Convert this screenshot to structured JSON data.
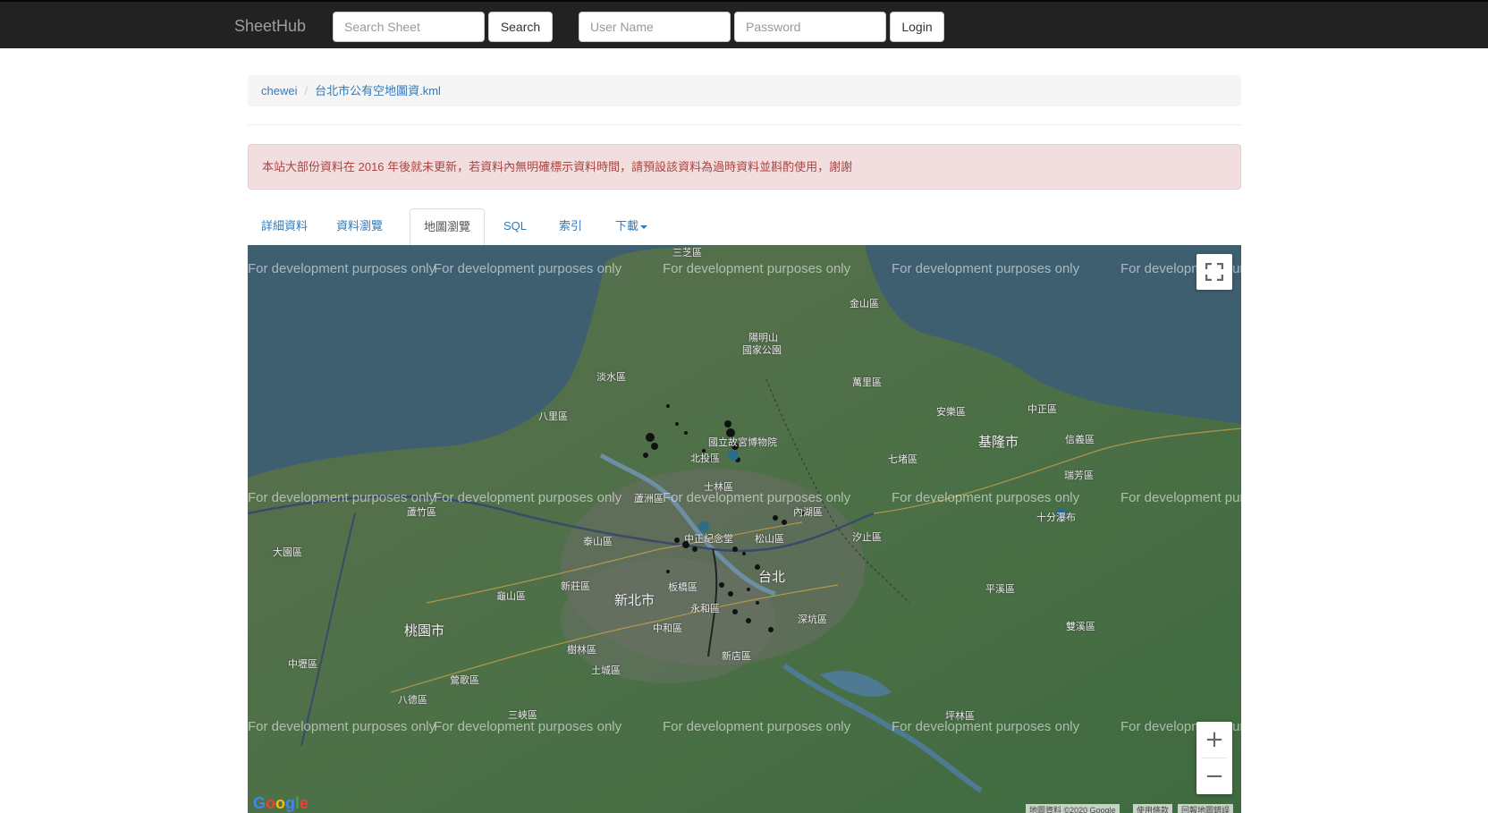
{
  "navbar": {
    "brand": "SheetHub",
    "search_placeholder": "Search Sheet",
    "search_button": "Search",
    "username_placeholder": "User Name",
    "password_placeholder": "Password",
    "login_button": "Login"
  },
  "breadcrumb": {
    "user": "chewei",
    "separator": "/",
    "file": "台北市公有空地圖資.kml"
  },
  "alert": {
    "text": "本站大部份資料在 2016 年後就未更新，若資料內無明確標示資料時間，請預設該資料為過時資料並斟酌使用，謝謝"
  },
  "tabs": [
    {
      "label": "詳細資料",
      "active": false
    },
    {
      "label": "資料瀏覽",
      "active": false
    },
    {
      "label": "地圖瀏覽",
      "active": true
    },
    {
      "label": "SQL",
      "active": false
    },
    {
      "label": "索引",
      "active": false
    },
    {
      "label": "下載",
      "active": false,
      "dropdown": true
    }
  ],
  "map": {
    "watermark": "For development purposes only",
    "place_labels": {
      "sanzhi": "三芝區",
      "jinshan": "金山區",
      "yangmingshan": "陽明山",
      "national_park": "國家公園",
      "danshui": "淡水區",
      "wanli": "萬里區",
      "bali": "八里區",
      "anle": "安樂區",
      "zhongzheng_kl": "中正區",
      "keelung": "基隆市",
      "xinyi_kl": "信義區",
      "palace_museum": "國立故宮博物院",
      "beitou": "北投區",
      "qidu": "七堵區",
      "ruifang": "瑞芳區",
      "shilin": "士林區",
      "luzhou": "蘆洲區",
      "luzhu": "蘆竹區",
      "neihu": "內湖區",
      "shifen": "十分瀑布",
      "dayuan": "大園區",
      "taishan": "泰山區",
      "cks_memorial": "中正紀念堂",
      "songshan": "松山區",
      "xizhi": "汐止區",
      "xinzhuang": "新莊區",
      "taipei": "台北",
      "guishan": "龜山區",
      "newtaipei": "新北市",
      "banqiao": "板橋區",
      "pingxi": "平溪區",
      "yonghe": "永和區",
      "shenkeng": "深坑區",
      "taoyuan": "桃園市",
      "zhonghe": "中和區",
      "shuangxi": "雙溪區",
      "zhongli": "中壢區",
      "shulin": "樹林區",
      "xindian": "新店區",
      "yingge": "鶯歌區",
      "tucheng": "土城區",
      "bade": "八德區",
      "sanxia": "三峽區",
      "pinglin": "坪林區"
    },
    "fullscreen_icon": "fullscreen-icon",
    "zoom_in": "+",
    "zoom_out": "−",
    "logo": "Google",
    "attribution": [
      "地圖資料 ©2020 Google",
      "使用條款",
      "回報地圖錯誤"
    ]
  }
}
